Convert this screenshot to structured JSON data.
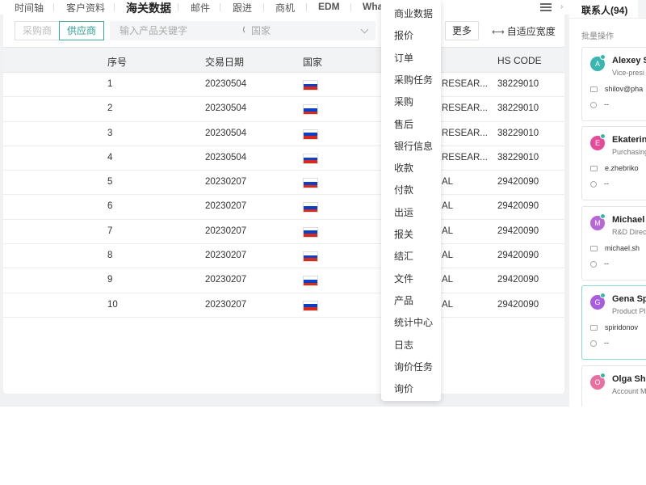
{
  "tabs": [
    {
      "label": "时间轴"
    },
    {
      "label": "客户资料"
    },
    {
      "label": "海关数据"
    },
    {
      "label": "邮件"
    },
    {
      "label": "跟进"
    },
    {
      "label": "商机"
    },
    {
      "label": "EDM"
    },
    {
      "label": "Wha"
    }
  ],
  "filter": {
    "buyer_label": "采购商",
    "supplier_label": "供应商",
    "search_placeholder": "输入产品关键字",
    "country_placeholder": "国家",
    "more_label": "更多",
    "autofit_label": "自适应宽度"
  },
  "table": {
    "headers": [
      "序号",
      "交易日期",
      "国家",
      "HS CODE"
    ],
    "rows": [
      {
        "no": "1",
        "date": "20230504",
        "company": "RESEAR...",
        "hs": "38229010"
      },
      {
        "no": "2",
        "date": "20230504",
        "company": "RESEAR...",
        "hs": "38229010"
      },
      {
        "no": "3",
        "date": "20230504",
        "company": "RESEAR...",
        "hs": "38229010"
      },
      {
        "no": "4",
        "date": "20230504",
        "company": "RESEAR...",
        "hs": "38229010"
      },
      {
        "no": "5",
        "date": "20230207",
        "company": "AL",
        "hs": "29420090"
      },
      {
        "no": "6",
        "date": "20230207",
        "company": "AL",
        "hs": "29420090"
      },
      {
        "no": "7",
        "date": "20230207",
        "company": "AL",
        "hs": "29420090"
      },
      {
        "no": "8",
        "date": "20230207",
        "company": "AL",
        "hs": "29420090"
      },
      {
        "no": "9",
        "date": "20230207",
        "company": "AL",
        "hs": "29420090"
      },
      {
        "no": "10",
        "date": "20230207",
        "company": "AL",
        "hs": "29420090"
      }
    ]
  },
  "dropdown": {
    "items": [
      "商业数据",
      "报价",
      "订单",
      "采购任务",
      "采购",
      "售后",
      "银行信息",
      "收款",
      "付款",
      "出运",
      "报关",
      "结汇",
      "文件",
      "产品",
      "统计中心",
      "日志",
      "询价任务",
      "询价"
    ]
  },
  "contacts": {
    "title": "联系人(94)",
    "batch_label": "批量操作",
    "items": [
      {
        "initial": "A",
        "name": "Alexey S",
        "title": "Vice-presi",
        "email": "shilov@pha",
        "phone": "--",
        "color": "#3ab6b0"
      },
      {
        "initial": "E",
        "name": "Ekaterin",
        "title": "Purchasing",
        "email": "e.zhebriko",
        "phone": "--",
        "color": "#e84a9a"
      },
      {
        "initial": "M",
        "name": "Michael",
        "title": "R&D Direc",
        "email": "michael.sh",
        "phone": "--",
        "color": "#b668d6"
      },
      {
        "initial": "G",
        "name": "Gena Sp",
        "title": "Product Pl",
        "email": "spiridonov",
        "phone": "--",
        "color": "#a85ce0"
      },
      {
        "initial": "O",
        "name": "Olga She",
        "title": "Account M",
        "email": "",
        "phone": "",
        "color": "#e86f9f"
      }
    ]
  }
}
